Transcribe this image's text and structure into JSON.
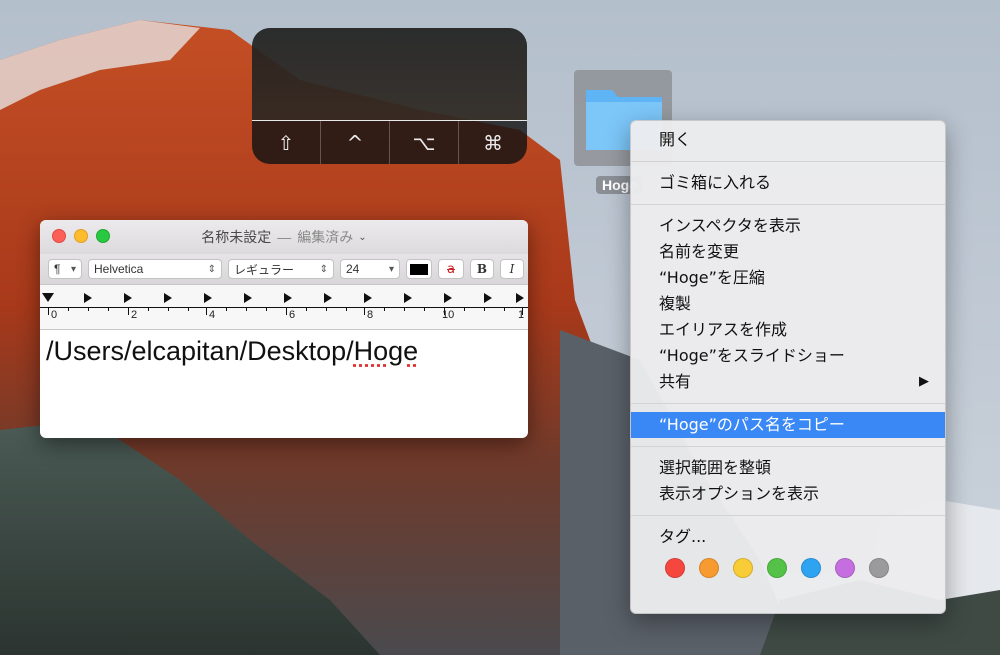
{
  "hud": {
    "keys": [
      "⇧",
      "^",
      "⌥",
      "⌘"
    ]
  },
  "desktop": {
    "folder_label": "Hoge"
  },
  "textedit": {
    "title_doc": "名称未設定",
    "title_sep": "—",
    "title_state": "編集済み",
    "toolbar": {
      "paragraph": "¶",
      "font": "Helvetica",
      "style": "レギュラー",
      "size": "24",
      "bold": "B",
      "italic": "I",
      "strike_label": "a"
    },
    "ruler_labels": [
      "0",
      "2",
      "4",
      "6",
      "8",
      "10",
      "1"
    ],
    "content": "/Users/elcapitan/Desktop/",
    "content_misspelled": "Hoge"
  },
  "context_menu": {
    "items": [
      "開く",
      "ゴミ箱に入れる",
      "インスペクタを表示",
      "名前を変更",
      "“Hoge”を圧縮",
      "複製",
      "エイリアスを作成",
      "“Hoge”をスライドショー",
      "共有",
      "“Hoge”のパス名をコピー",
      "選択範囲を整頓",
      "表示オプションを表示",
      "タグ..."
    ],
    "submenu_arrow": "▶",
    "tag_colors": [
      "#f5473f",
      "#f79a30",
      "#f7cc36",
      "#53c247",
      "#2ea3f2",
      "#c56ee0",
      "#9b9b9e"
    ]
  }
}
